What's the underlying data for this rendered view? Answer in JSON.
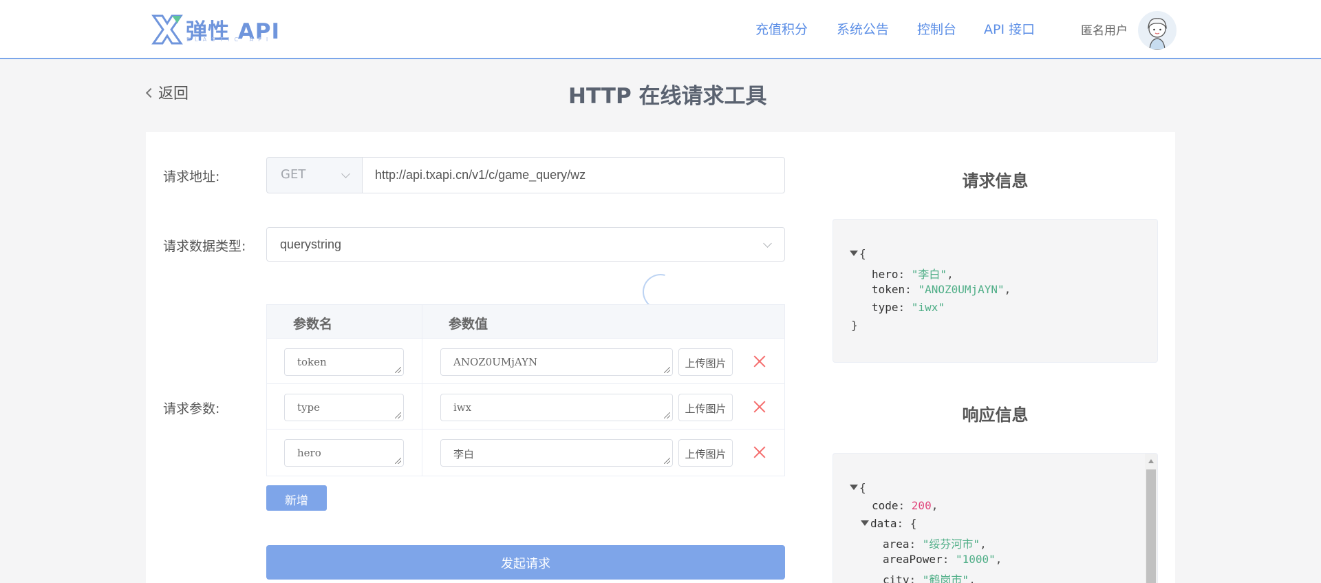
{
  "header": {
    "logo_text": "弹性 API",
    "logo_subtext": "ELASTIC API",
    "nav": [
      "充值积分",
      "系统公告",
      "控制台",
      "API 接口"
    ],
    "user_name": "匿名用户",
    "colors": {
      "accent": "#5b8ee6",
      "border": "#7ba6ea"
    }
  },
  "back_label": "返回",
  "page_title": "HTTP 在线请求工具",
  "form": {
    "url_label": "请求地址:",
    "method": "GET",
    "url": "http://api.txapi.cn/v1/c/game_query/wz",
    "type_label": "请求数据类型:",
    "data_type": "querystring",
    "params_label": "请求参数:",
    "col_name": "参数名",
    "col_value": "参数值",
    "params": [
      {
        "name": "token",
        "value": "ANOZ0UMjAYN",
        "upload": "上传图片"
      },
      {
        "name": "type",
        "value": "iwx",
        "upload": "上传图片"
      },
      {
        "name": "hero",
        "value": "李白",
        "upload": "上传图片"
      }
    ],
    "add_label": "新增",
    "submit_label": "发起请求",
    "button_color": "#7ea5e9",
    "delete_color": "#f56c6c"
  },
  "request_info": {
    "title": "请求信息",
    "lines": [
      {
        "open": "{"
      },
      {
        "key": "hero",
        "value": "\"李白\"",
        "comma": ","
      },
      {
        "key": "token",
        "value": "\"ANOZ0UMjAYN\"",
        "comma": ","
      },
      {
        "key": "type",
        "value": "\"iwx\""
      },
      {
        "close": "}"
      }
    ]
  },
  "response_info": {
    "title": "响应信息",
    "lines": [
      {
        "open": "{"
      },
      {
        "key": "code",
        "value": "200",
        "comma": ","
      },
      {
        "key": "data",
        "open": "{"
      },
      {
        "key": "area",
        "value": "\"绥芬河市\"",
        "comma": ","
      },
      {
        "key": "areaPower",
        "value": "\"1000\"",
        "comma": ","
      },
      {
        "key": "city",
        "value": "\"鹤岗市\"",
        "comma": ","
      }
    ]
  }
}
